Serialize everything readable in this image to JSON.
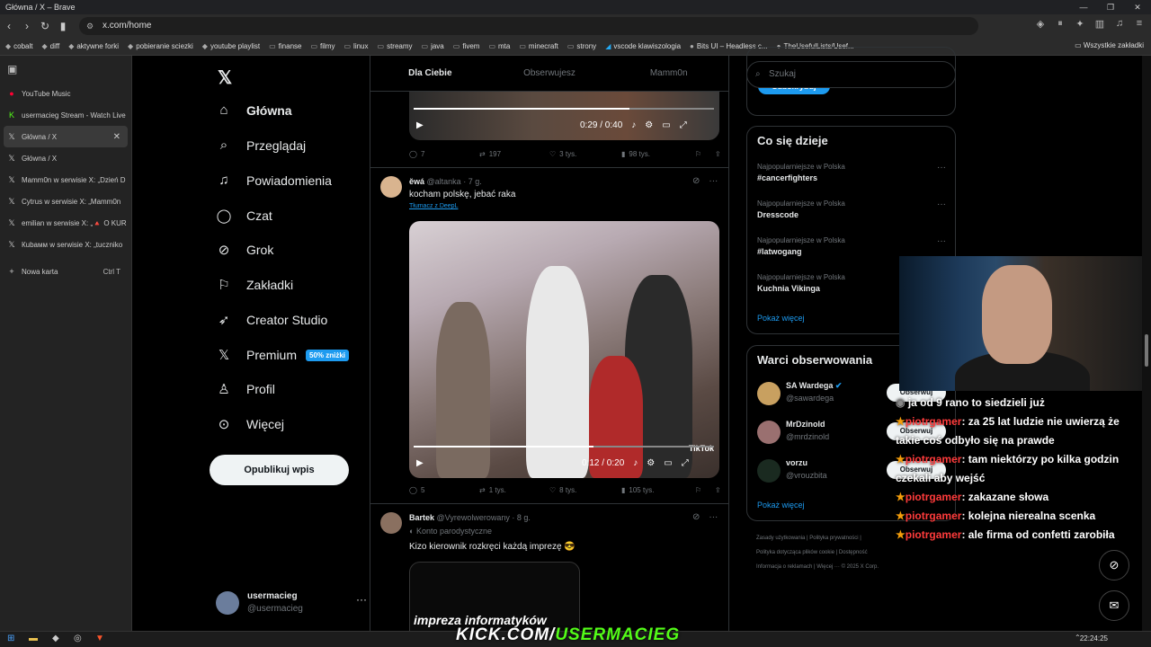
{
  "browser": {
    "window_title": "Główna / X – Brave",
    "url": "x.com/home",
    "bookmarks": [
      "cobalt",
      "diff",
      "aktywne forki",
      "pobieranie sciezki",
      "youtube playlist",
      "finanse",
      "filmy",
      "linux",
      "streamy",
      "java",
      "fivem",
      "mta",
      "minecraft",
      "strony",
      "vscode klawiszologia",
      "Bits UI – Headless c...",
      "TheUsefulLists/Usef..."
    ],
    "bookmarks_right": "Wszystkie zakładki",
    "tabs": [
      {
        "label": "YouTube Music",
        "icon": "youtube-music-icon",
        "color": "#ff0033"
      },
      {
        "label": "usermacieg Stream - Watch Live",
        "icon": "kick-icon",
        "color": "#53fc18"
      },
      {
        "label": "Główna / X",
        "icon": "x-icon",
        "color": "#ffffff",
        "active": true
      },
      {
        "label": "Główna / X",
        "icon": "x-icon",
        "color": "#ffffff"
      },
      {
        "label": "Mamm0n w serwisie X: „Dzień D",
        "icon": "x-icon",
        "color": "#ffffff"
      },
      {
        "label": "Cytrus w serwisie X: „Mamm0n",
        "icon": "x-icon",
        "color": "#ffffff"
      },
      {
        "label": "emilian w serwisie X: „🔺 O KUR",
        "icon": "x-icon",
        "color": "#ffffff"
      },
      {
        "label": "Кubамм w serwisie X: „tuczniko",
        "icon": "x-icon",
        "color": "#ffffff"
      }
    ],
    "new_tab": {
      "label": "Nowa karta",
      "shortcut": "Ctrl T"
    }
  },
  "nav": {
    "items": [
      {
        "label": "Główna",
        "icon": "home-icon"
      },
      {
        "label": "Przeglądaj",
        "icon": "search-icon"
      },
      {
        "label": "Powiadomienia",
        "icon": "bell-icon"
      },
      {
        "label": "Czat",
        "icon": "chat-icon"
      },
      {
        "label": "Grok",
        "icon": "grok-icon"
      },
      {
        "label": "Zakładki",
        "icon": "bookmark-icon"
      },
      {
        "label": "Creator Studio",
        "icon": "rocket-icon"
      },
      {
        "label": "Premium",
        "icon": "x-icon"
      },
      {
        "label": "Profil",
        "icon": "person-icon"
      },
      {
        "label": "Więcej",
        "icon": "more-icon"
      }
    ],
    "premium_badge": "50% zniżki",
    "post_button": "Opublikuj wpis",
    "account": {
      "name": "usermacieg",
      "handle": "@usermacieg"
    }
  },
  "feed": {
    "tabs": [
      "Dla Ciebie",
      "Obserwujesz",
      "Mamm0n"
    ],
    "tweet0": {
      "time": "0:29 / 0:40",
      "replies": "7",
      "reposts": "197",
      "likes": "3 tys.",
      "views": "98 tys.",
      "progress": 0.72
    },
    "tweet1": {
      "name": "ĕwá",
      "handle": "@altanka",
      "age": "7 g.",
      "text": "kocham polskę, jebać raka",
      "translate": "Tłumacz z DeepL",
      "video_time": "0:12 / 0:20",
      "video_progress": 0.6,
      "tiktok": "TikTok",
      "replies": "5",
      "reposts": "1 tys.",
      "likes": "8 tys.",
      "views": "105 tys."
    },
    "tweet2": {
      "name": "Bartek",
      "handle": "@Vyrewolwerowany",
      "age": "8 g.",
      "label": "Konto parodystyczne",
      "text": "Kizo kierownik rozkręci każdą imprezę 😎",
      "video_caption": "impreza informatyków"
    }
  },
  "sidebar": {
    "search_placeholder": "Szukaj",
    "subscribe": "Subskrybuj",
    "trends_title": "Co się dzieje",
    "trends": [
      {
        "context": "Najpopularniejsze w Polska",
        "tag": "#cancerfighters"
      },
      {
        "context": "Najpopularniejsze w Polska",
        "tag": "Dresscode"
      },
      {
        "context": "Najpopularniejsze w Polska",
        "tag": "#latwogang"
      },
      {
        "context": "Najpopularniejsze w Polska",
        "tag": "Kuchnia Vikinga"
      }
    ],
    "show_more": "Pokaż więcej",
    "wto_title": "Warci obserwowania",
    "wto": [
      {
        "name": "SA Wardega",
        "handle": "@sawardega",
        "verified": true
      },
      {
        "name": "MrDzinold",
        "handle": "@mrdzinold",
        "verified": false
      },
      {
        "name": "vorzu",
        "handle": "@vrouzbita",
        "verified": false
      }
    ],
    "follow": "Obserwuj",
    "footer1": "Zasady użytkowania  |  Polityka prywatności  |",
    "footer2": "Polityka dotycząca plików cookie  |  Dostępność",
    "footer3": "Informacja o reklamach  |  Więcej ···  © 2025 X Corp."
  },
  "chat": [
    {
      "user": "",
      "text": "ja od 9 rano to siedzieli już"
    },
    {
      "user": "piotrgamer",
      "text": "za 25 lat ludzie nie uwierzą że takie coś odbyło się na prawde"
    },
    {
      "user": "piotrgamer",
      "text": "tam niektórzy po kilka godzin czekali aby wejść"
    },
    {
      "user": "piotrgamer",
      "text": "zakazane słowa"
    },
    {
      "user": "piotrgamer",
      "text": "kolejna nierealna scenka"
    },
    {
      "user": "piotrgamer",
      "text": "ale firma od confetti zarobiła"
    }
  ],
  "overlay": {
    "kick_prefix": "KICK.COM/",
    "kick_channel": "USERMACIEG"
  },
  "taskbar": {
    "clock": "22:24:25"
  }
}
